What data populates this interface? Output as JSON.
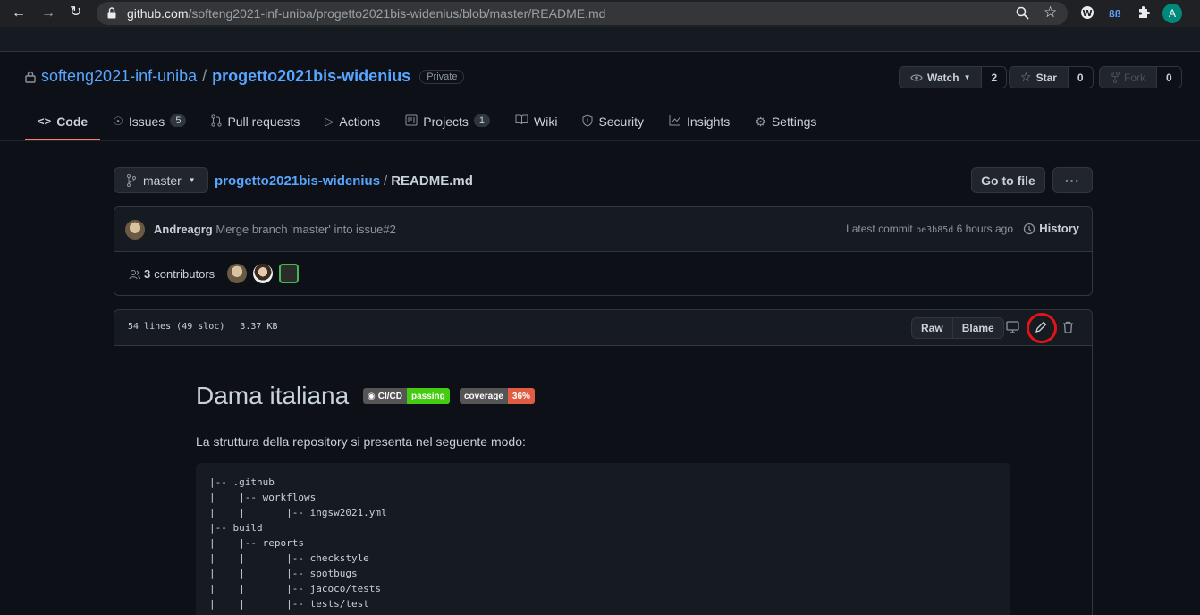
{
  "browser": {
    "url_host": "github.com",
    "url_path": "/softeng2021-inf-uniba/progetto2021bis-widenius/blob/master/README.md",
    "profile_initial": "A",
    "icons": [
      "back-arrow-icon",
      "forward-arrow-icon",
      "reload-icon",
      "lock-icon",
      "zoom-icon",
      "star-icon",
      "extension-w-icon",
      "extension-ai-icon",
      "puzzle-icon"
    ]
  },
  "repo": {
    "owner": "softeng2021-inf-uniba",
    "separator": "/",
    "name": "progetto2021bis-widenius",
    "visibility": "Private",
    "watch_label": "Watch",
    "watch_count": "2",
    "star_label": "Star",
    "star_count": "0",
    "fork_label": "Fork",
    "fork_count": "0"
  },
  "tabs": [
    {
      "label": "Code",
      "icon": "code-icon"
    },
    {
      "label": "Issues",
      "icon": "issue-icon",
      "count": "5"
    },
    {
      "label": "Pull requests",
      "icon": "pull-request-icon"
    },
    {
      "label": "Actions",
      "icon": "play-icon"
    },
    {
      "label": "Projects",
      "icon": "project-icon",
      "count": "1"
    },
    {
      "label": "Wiki",
      "icon": "book-icon"
    },
    {
      "label": "Security",
      "icon": "shield-icon"
    },
    {
      "label": "Insights",
      "icon": "graph-icon"
    },
    {
      "label": "Settings",
      "icon": "gear-icon"
    }
  ],
  "file_nav": {
    "branch": "master",
    "repo_link": "progetto2021bis-widenius",
    "separator": "/",
    "file": "README.md",
    "go_to_file": "Go to file",
    "more": "···"
  },
  "commit": {
    "author": "Andreagrg",
    "message": "Merge branch 'master' into issue#2",
    "latest_label": "Latest commit",
    "sha": "be3b85d",
    "time": "6 hours ago",
    "history_label": "History",
    "contributors_count": "3",
    "contributors_label": "contributors"
  },
  "file": {
    "lines": "54 lines (49 sloc)",
    "size": "3.37 KB",
    "raw_label": "Raw",
    "blame_label": "Blame"
  },
  "readme": {
    "title": "Dama italiana",
    "badge_ci_label": "CI/CD",
    "badge_ci_status": "passing",
    "badge_cov_label": "coverage",
    "badge_cov_value": "36%",
    "intro": "La struttura della repository si presenta nel seguente modo:",
    "code_lines": [
      "|-- .github",
      "|    |-- workflows",
      "|    |       |-- ingsw2021.yml",
      "|-- build",
      "|    |-- reports",
      "|    |       |-- checkstyle",
      "|    |       |-- spotbugs",
      "|    |       |-- jacoco/tests",
      "|    |       |-- tests/test"
    ]
  },
  "colors": {
    "accent_link": "#58a6ff",
    "tab_underline": "#f78166",
    "badge_passing": "#4c1",
    "badge_coverage": "#e05d44",
    "highlight_ring": "#e3131b"
  }
}
